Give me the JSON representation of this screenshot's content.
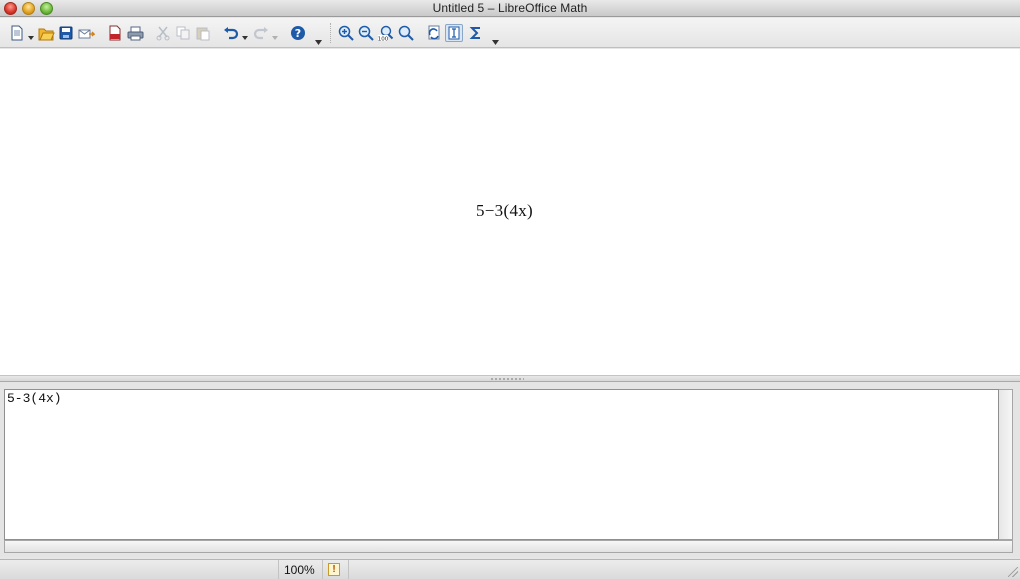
{
  "window": {
    "title": "Untitled 5 – LibreOffice Math"
  },
  "toolbar": {
    "buttons": [
      {
        "name": "new-document-icon"
      },
      {
        "name": "open-folder-icon"
      },
      {
        "name": "save-icon"
      },
      {
        "name": "email-document-icon"
      },
      {
        "name": "export-pdf-icon"
      },
      {
        "name": "print-icon"
      },
      {
        "name": "cut-icon"
      },
      {
        "name": "copy-icon"
      },
      {
        "name": "paste-icon"
      },
      {
        "name": "undo-icon"
      },
      {
        "name": "redo-icon"
      },
      {
        "name": "help-icon"
      },
      {
        "name": "zoom-in-icon"
      },
      {
        "name": "zoom-out-icon"
      },
      {
        "name": "zoom-100-icon"
      },
      {
        "name": "show-all-icon"
      },
      {
        "name": "update-icon"
      },
      {
        "name": "formula-cursor-icon"
      },
      {
        "name": "symbols-icon"
      }
    ]
  },
  "display": {
    "formula_text": "5−3(4x)"
  },
  "command": {
    "text": "5-3(4x)"
  },
  "statusbar": {
    "zoom": "100%",
    "modified_indicator": "!"
  }
}
